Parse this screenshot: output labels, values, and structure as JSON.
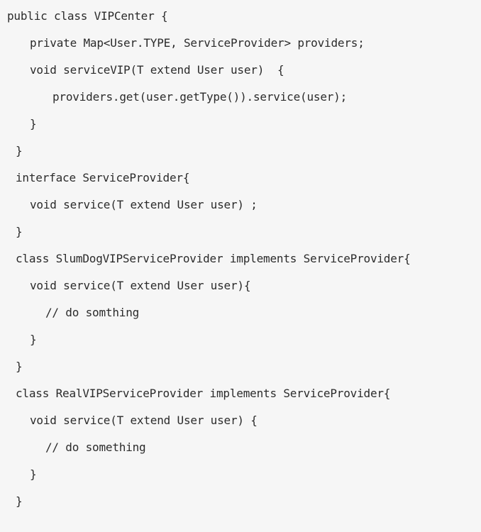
{
  "code": {
    "lines": [
      "public class VIPCenter {",
      "private Map<User.TYPE, ServiceProvider> providers;",
      "void serviceVIP(T extend User user)  {",
      "providers.get(user.getType()).service(user);",
      "}",
      "}",
      "interface ServiceProvider{",
      "void service(T extend User user) ;",
      "}",
      "class SlumDogVIPServiceProvider implements ServiceProvider{",
      "void service(T extend User user){",
      "// do somthing",
      "}",
      "}",
      "class RealVIPServiceProvider implements ServiceProvider{",
      "void service(T extend User user) {",
      "// do something",
      "}",
      "}"
    ]
  }
}
